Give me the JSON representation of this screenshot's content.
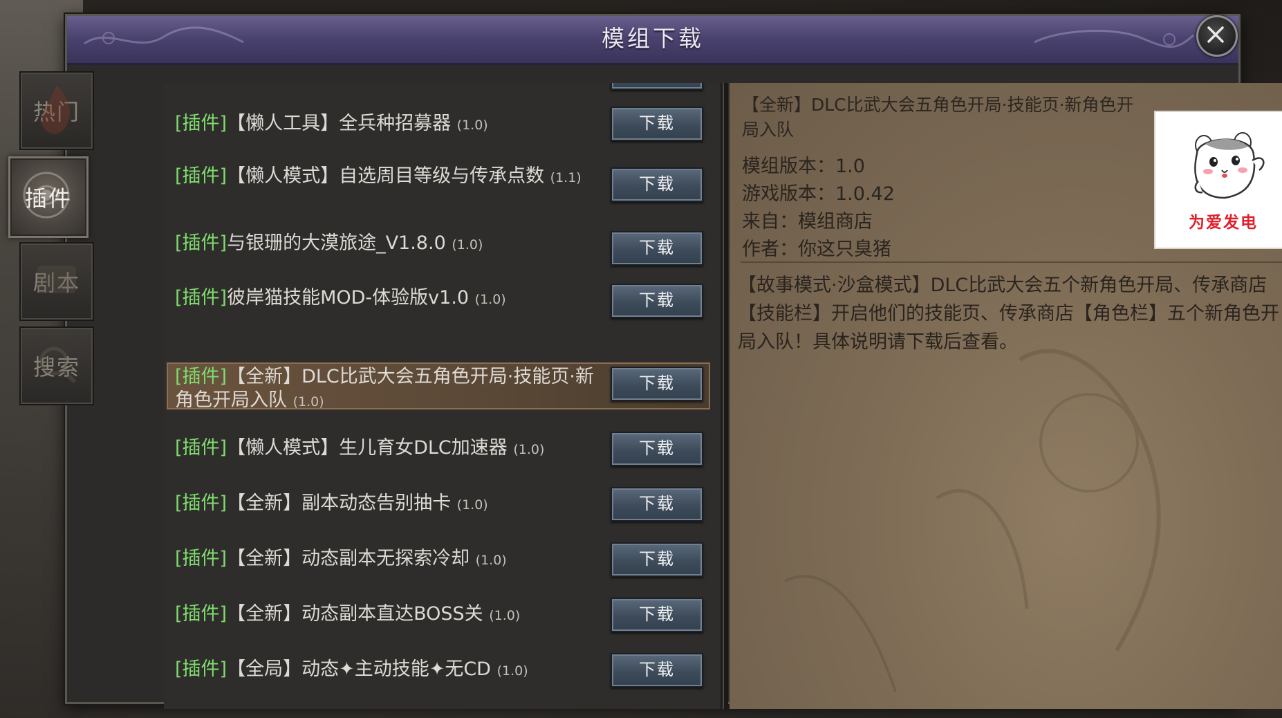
{
  "window": {
    "title": "模组下载"
  },
  "side_tabs": [
    {
      "label": "热门",
      "active": false
    },
    {
      "label": "插件",
      "active": true
    },
    {
      "label": "剧本",
      "active": false
    },
    {
      "label": "搜索",
      "active": false
    }
  ],
  "list": {
    "download_label": "下载",
    "items": [
      {
        "tag": "[插件]",
        "name": "【懒人工具】全兵种招募器",
        "version": "(1.0)",
        "selected": false
      },
      {
        "tag": "[插件]",
        "name": "【懒人模式】自选周目等级与传承点数",
        "version": "(1.1)",
        "selected": false
      },
      {
        "tag": "[插件]",
        "name": "与银珊的大漠旅途_V1.8.0",
        "version": "(1.0)",
        "selected": false
      },
      {
        "tag": "[插件]",
        "name": "彼岸猫技能MOD-体验版v1.0",
        "version": "(1.0)",
        "selected": false
      },
      {
        "tag": "[插件]",
        "name": "【全新】DLC比武大会五角色开局·技能页·新角色开局入队",
        "version": "(1.0)",
        "selected": true
      },
      {
        "tag": "[插件]",
        "name": "【懒人模式】生儿育女DLC加速器",
        "version": "(1.0)",
        "selected": false
      },
      {
        "tag": "[插件]",
        "name": "【全新】副本动态告别抽卡",
        "version": "(1.0)",
        "selected": false
      },
      {
        "tag": "[插件]",
        "name": "【全新】动态副本无探索冷却",
        "version": "(1.0)",
        "selected": false
      },
      {
        "tag": "[插件]",
        "name": "【全新】动态副本直达BOSS关",
        "version": "(1.0)",
        "selected": false
      },
      {
        "tag": "[插件]",
        "name": "【全局】动态✦主动技能✦无CD",
        "version": "(1.0)",
        "selected": false
      }
    ]
  },
  "detail": {
    "title": "【全新】DLC比武大会五角色开局·技能页·新角色开局入队",
    "mod_version": "模组版本：1.0",
    "game_version": "游戏版本：1.0.42",
    "source": "来自：模组商店",
    "author": "作者：你这只臭猪",
    "description": "【故事模式·沙盒模式】DLC比武大会五个新角色开局、传承商店【技能栏】开启他们的技能页、传承商店【角色栏】五个新角色开局入队！具体说明请下载后查看。",
    "thumbnail_caption": "为爱发电",
    "thumbnail_icon": "hamster-icon"
  },
  "colors": {
    "tag_green": "#7fdc6e",
    "title_bar": "#4b4370",
    "download_button": "#3e4b5a",
    "selected_row": "#5a4836",
    "detail_bg": "#7d6b55"
  }
}
